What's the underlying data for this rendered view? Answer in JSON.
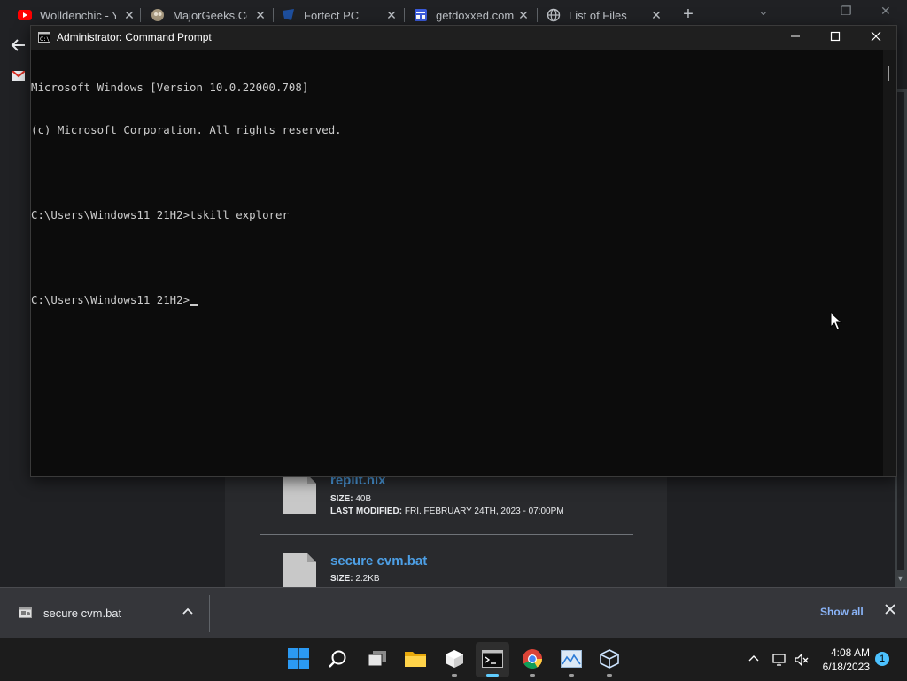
{
  "browser": {
    "tabs": [
      {
        "title": "Wolldenchic - Y",
        "favicon": "youtube-icon"
      },
      {
        "title": "MajorGeeks.Cor",
        "favicon": "majorgeeks-icon"
      },
      {
        "title": "Fortect PC",
        "favicon": "fortect-icon"
      },
      {
        "title": "getdoxxed.com",
        "favicon": "getdoxxed-icon"
      },
      {
        "title": "List of Files",
        "favicon": "globe-icon"
      }
    ],
    "new_tab_label": "+",
    "tab_close_label": "✕"
  },
  "page": {
    "files": [
      {
        "name": "replit.nix",
        "size_label": "SIZE:",
        "size": "40B",
        "modified_label": "LAST MODIFIED:",
        "modified": "FRI. FEBRUARY 24TH, 2023 - 07:00PM"
      },
      {
        "name": "secure cvm.bat",
        "size_label": "SIZE:",
        "size": "2.2KB"
      }
    ]
  },
  "cmd": {
    "title": "Administrator: Command Prompt",
    "lines": [
      "Microsoft Windows [Version 10.0.22000.708]",
      "(c) Microsoft Corporation. All rights reserved.",
      "",
      "C:\\Users\\Windows11_21H2>tskill explorer",
      "",
      "C:\\Users\\Windows11_21H2>"
    ]
  },
  "downloads": {
    "item_name": "secure cvm.bat",
    "show_all": "Show all"
  },
  "taskbar": {
    "time": "4:08 AM",
    "date": "6/18/2023",
    "notification_count": "1"
  },
  "colors": {
    "accent": "#60cdff",
    "link": "#4d9fe5",
    "console_bg": "#0c0c0c"
  }
}
